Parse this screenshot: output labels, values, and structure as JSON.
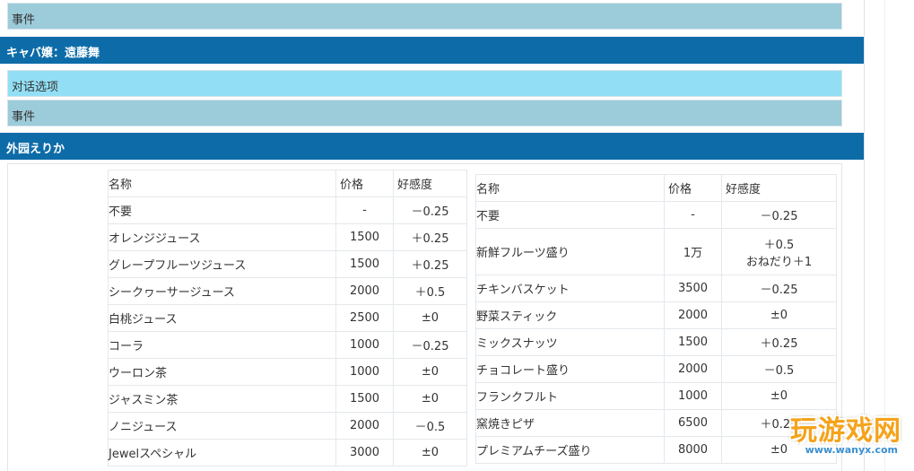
{
  "sections": {
    "event_1": "事件",
    "host_1": "キャバ嬢：遠藤舞",
    "dialog": "对话选项",
    "event_2": "事件",
    "host_2": "外园えりか"
  },
  "table_left": {
    "headers": [
      "名称",
      "价格",
      "好感度"
    ],
    "rows": [
      [
        "不要",
        "-",
        "－0.25"
      ],
      [
        "オレンジジュース",
        "1500",
        "＋0.25"
      ],
      [
        "グレープフルーツジュース",
        "1500",
        "＋0.25"
      ],
      [
        "シークヮーサージュース",
        "2000",
        "＋0.5"
      ],
      [
        "白桃ジュース",
        "2500",
        "±0"
      ],
      [
        "コーラ",
        "1000",
        "－0.25"
      ],
      [
        "ウーロン茶",
        "1000",
        "±0"
      ],
      [
        "ジャスミン茶",
        "1500",
        "±0"
      ],
      [
        "ノニジュース",
        "2000",
        "－0.5"
      ],
      [
        "Jewelスペシャル",
        "3000",
        "±0"
      ]
    ]
  },
  "table_right": {
    "headers": [
      "名称",
      "价格",
      "好感度"
    ],
    "rows": [
      [
        "不要",
        "-",
        "－0.25"
      ],
      [
        "新鮮フルーツ盛り",
        "1万",
        "＋0.5\nおねだり＋1"
      ],
      [
        "チキンバスケット",
        "3500",
        "－0.25"
      ],
      [
        "野菜スティック",
        "2000",
        "±0"
      ],
      [
        "ミックスナッツ",
        "1500",
        "＋0.25"
      ],
      [
        "チョコレート盛り",
        "2000",
        "－0.5"
      ],
      [
        "フランクフルト",
        "1000",
        "±0"
      ],
      [
        "窯焼きピザ",
        "6500",
        "＋0.25"
      ],
      [
        "プレミアムチーズ盛り",
        "8000",
        "±0"
      ]
    ]
  },
  "watermark": {
    "brand": "玩游戏网",
    "url": "www.wanyx.com"
  },
  "colors": {
    "header_bar": "#0d6ca8",
    "event_bar": "#9ccbda",
    "dialog_bar": "#92dff5"
  }
}
